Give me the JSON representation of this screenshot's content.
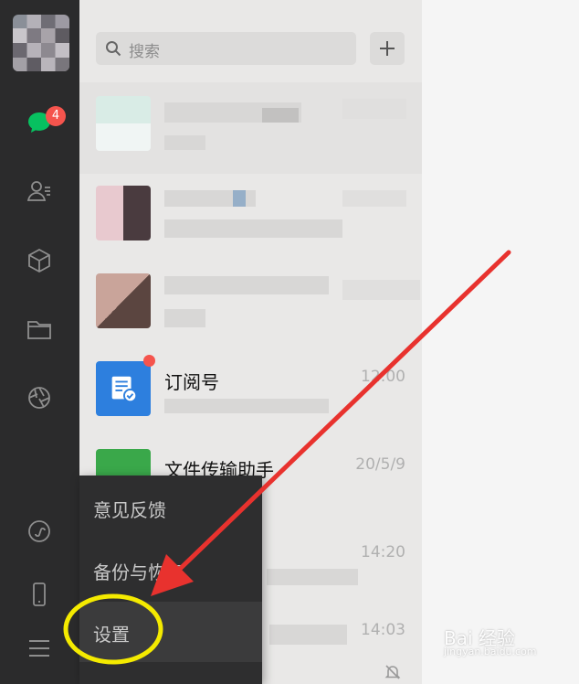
{
  "search": {
    "placeholder": "搜索"
  },
  "sidebar": {
    "unread_badge": "4"
  },
  "chats": [
    {
      "name": "订阅号",
      "time": "12:00"
    },
    {
      "name": "文件传输助手",
      "time": "20/5/9"
    },
    {
      "name": "",
      "time": "14:20"
    },
    {
      "name": "",
      "time": "14:03"
    }
  ],
  "menu": {
    "items": [
      {
        "label": "意见反馈"
      },
      {
        "label": "备份与恢复"
      },
      {
        "label": "设置"
      }
    ]
  },
  "watermark": {
    "brand": "Bai 经验",
    "url": "jingyan.baidu.com"
  },
  "colors": {
    "sidebar": "#2b2b2c",
    "chat_green": "#07c160",
    "badge_red": "#f5544d",
    "highlight_yellow": "#f4ea00",
    "arrow_red": "#e8322e"
  }
}
